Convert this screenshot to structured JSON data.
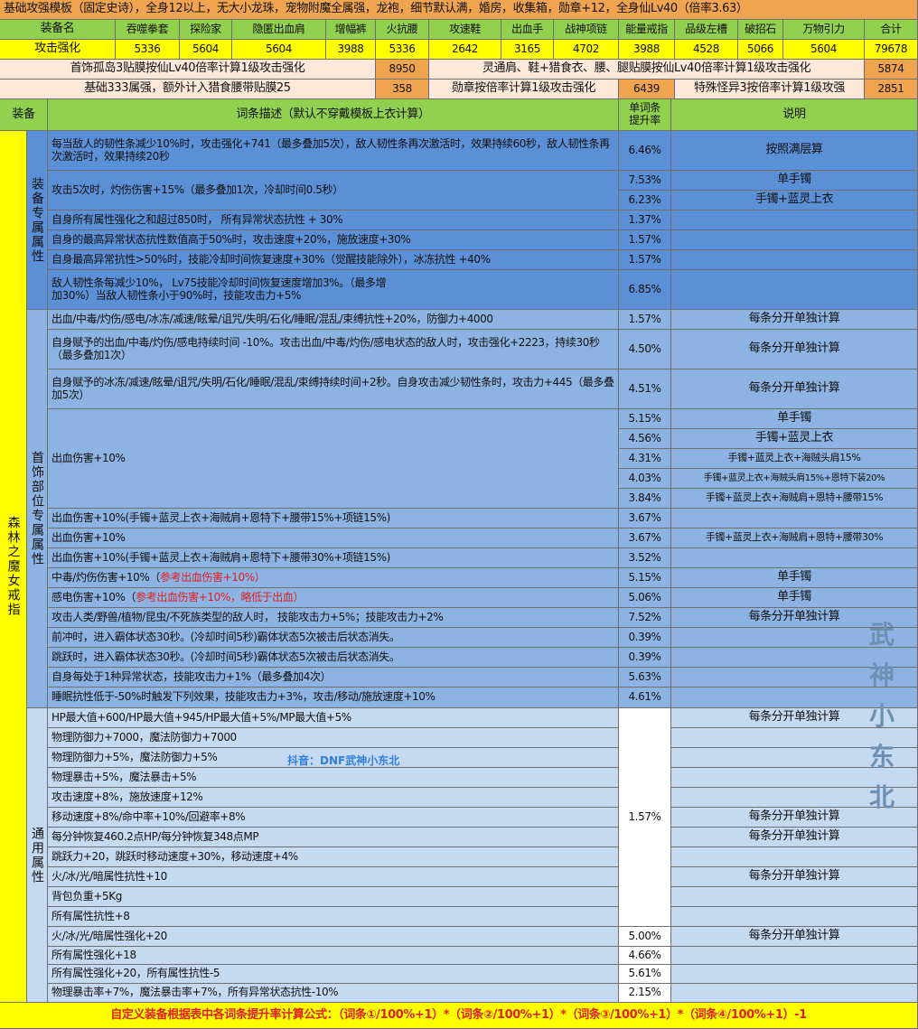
{
  "title": "基础攻强模板（固定史诗），全身12以上，无大小龙珠，宠物附魔全属强，龙袍，细节默认满，婚房，收集箱，勋章+12，全身仙Lv40（倍率3.63）",
  "summary": {
    "header_label": "装备名",
    "equipment": [
      "吞噬拳套",
      "探险家",
      "隐匿出血肩",
      "增幅裤",
      "火抗腰",
      "攻速鞋",
      "出血手",
      "战神项链",
      "能量戒指",
      "品级左槽",
      "破招石",
      "万物引力"
    ],
    "total_label": "合计",
    "row_label": "攻击强化",
    "values": [
      "5336",
      "5604",
      "5604",
      "3988",
      "5336",
      "2642",
      "3165",
      "4702",
      "3988",
      "4528",
      "5066",
      "5604"
    ],
    "total": "79678"
  },
  "extras": [
    {
      "label": "首饰孤岛3贴膜按仙Lv40倍率计算1级攻击强化",
      "value": "8950"
    },
    {
      "label": "灵通肩、鞋+猎食衣、腰、腿贴膜按仙Lv40倍率计算1级攻击强化",
      "value": "5874"
    },
    {
      "label": "基础333属强，额外计入猎食腰带贴膜25",
      "value": "358"
    },
    {
      "label": "勋章按倍率计算1级攻击强化",
      "value": "6439"
    },
    {
      "label": "特殊怪异3按倍率计算1级攻强",
      "value": "2851"
    }
  ],
  "headers": {
    "equip": "装备",
    "desc": "词条描述（默认不穿戴模板上衣计算）",
    "rate": "单词条提升率",
    "note": "说明"
  },
  "equip_name": "森林之魔女戒指",
  "sections": {
    "s1": "装备专属属性",
    "s2": "首饰部位专属属性",
    "s3": "通用属性"
  },
  "rows": [
    {
      "desc": "每当敌人的韧性条减少10%时，攻击强化+741（最多叠加5次），敌人韧性条再次激活时，效果持续60秒，敌人韧性条再次激活时，效果持续20秒"
    },
    {
      "desc": "攻击5次时，灼伤伤害+15%（最多叠加1次，冷却时间0.5秒）"
    },
    {
      "desc": "自身所有属性强化之和超过850时， 所有异常状态抗性 + 30%"
    },
    {
      "desc": "自身的最高异常状态抗性数值高于50%时，攻击速度+20%，施放速度+30%"
    },
    {
      "desc": "自身最高异常抗性>50%时，技能冷却时间恢复速度+30%（觉醒技能除外），冰冻抗性 +40%"
    },
    {
      "desc": "敌人韧性条每减少10%， Lv75技能冷却时间恢复速度增加3%。（最多增加30%）当敌人韧性条小于90%时，技能攻击力+5%"
    },
    {
      "desc": "出血/中毒/灼伤/感电/冰冻/减速/眩晕/诅咒/失明/石化/睡眠/混乱/束缚抗性+20%，防御力+4000"
    },
    {
      "desc": "自身赋予的出血/中毒/灼伤/感电持续时间 -10%。攻击出血/中毒/灼伤/感电状态的敌人时，攻击强化+2223，持续30秒（最多叠加1次）"
    },
    {
      "desc": "自身赋予的冰冻/减速/眩晕/诅咒/失明/石化/睡眠/混乱/束缚持续时间+2秒。自身攻击减少韧性条时，攻击力+445（最多叠加5次）"
    },
    {
      "desc": "出血伤害+10%"
    },
    {
      "desc": "出血伤害+10%(手镯+蓝灵上衣+海贼肩+恩特下+腰带15%+项链15%)"
    },
    {
      "desc": "出血伤害+10%"
    },
    {
      "desc": "出血伤害+10%(手镯+蓝灵上衣+海贼肩+恩特下+腰带30%+项链15%)"
    },
    {
      "desc": "中毒/灼伤伤害+10%（",
      "red": "参考出血伤害+10%）"
    },
    {
      "desc": "感电伤害+10%（",
      "red": "参考出血伤害+10%，略低于出血）"
    },
    {
      "desc": "攻击人类/野兽/植物/昆虫/不死族类型的敌人时， 技能攻击力+5%；技能攻击力+2%"
    },
    {
      "desc": "前冲时，进入霸体状态30秒。(冷却时间5秒)霸体状态5次被击后状态消失。"
    },
    {
      "desc": "跳跃时，进入霸体状态30秒。(冷却时间5秒)霸体状态5次被击后状态消失。"
    },
    {
      "desc": "自身每处于1种异常状态，技能攻击力+1%（最多叠加4次）"
    },
    {
      "desc": "睡眠抗性低于-50%时触发下列效果，技能攻击力+3%，攻击/移动/施放速度+10%"
    },
    {
      "desc": "HP最大值+600/HP最大值+945/HP最大值+5%/MP最大值+5%"
    },
    {
      "desc": "物理防御力+7000，魔法防御力+7000"
    },
    {
      "desc": "物理防御力+5%，魔法防御力+5%"
    },
    {
      "desc": "物理暴击+5%，魔法暴击+5%"
    },
    {
      "desc": "攻击速度+8%，施放速度+12%"
    },
    {
      "desc": "移动速度+8%/命中率+10%/回避率+8%"
    },
    {
      "desc": "每分钟恢复460.2点HP/每分钟恢复348点MP"
    },
    {
      "desc": "跳跃力+20，跳跃时移动速度+30%，移动速度+4%"
    },
    {
      "desc": "火/冰/光/暗属性抗性+10"
    },
    {
      "desc": "背包负重+5Kg"
    },
    {
      "desc": "所有属性抗性+8"
    },
    {
      "desc": "火/冰/光/暗属性强化+20"
    },
    {
      "desc": "所有属性强化+18"
    },
    {
      "desc": "所有属性强化+20，所有属性抗性-5"
    },
    {
      "desc": "物理暴击率+7%，魔法暴击率+7%，所有异常状态抗性-10%"
    }
  ],
  "rates": [
    "6.46%",
    "7.53%",
    "6.23%",
    "1.37%",
    "1.57%",
    "1.57%",
    "6.85%",
    "1.57%",
    "4.50%",
    "4.51%",
    "5.15%",
    "4.56%",
    "4.31%",
    "4.03%",
    "3.84%",
    "3.67%",
    "3.67%",
    "3.52%",
    "5.15%",
    "5.06%",
    "7.52%",
    "0.39%",
    "0.39%",
    "5.63%",
    "4.61%",
    "1.57%",
    "5.00%",
    "4.66%",
    "5.61%",
    "2.15%"
  ],
  "notes": {
    "per_calc": "每条分开单独计算",
    "stack": "按照满层算",
    "bracelet": "单手镯",
    "bracelet_top": "手镯+蓝灵上衣",
    "n1": "手镯+蓝灵上衣+海贼头肩15%",
    "n2": "手镯+蓝灵上衣+海贼头肩15%+恩特下装20%",
    "n3": "手镯+蓝灵上衣+海贼肩+恩特+腰带15%",
    "n4": "手镯+蓝灵上衣+海贼肩+恩特+腰带30%"
  },
  "watermark": [
    "武",
    "神",
    "小",
    "东",
    "北"
  ],
  "tiktok": "抖音：DNF武神小东北",
  "footer": "自定义装备根据表中各词条提升率计算公式：（词条①/100%+1）*（词条②/100%+1）*（词条③/100%+1）*（词条④/100%+1）-1",
  "colors": {
    "green": "#92d050",
    "yellow": "#ffff00",
    "orange": "#f0a44f",
    "peach": "#fde9d9",
    "blue1": "#5b8fd6",
    "blue2": "#8db3e2",
    "blue3": "#c5d9f1"
  }
}
